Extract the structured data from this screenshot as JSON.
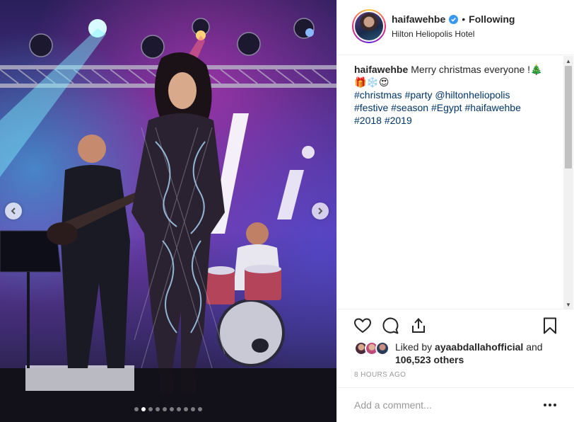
{
  "post": {
    "username": "haifawehbe",
    "separator": "•",
    "follow_status": "Following",
    "location": "Hilton Heliopolis Hotel"
  },
  "caption": {
    "username": "haifawehbe",
    "text": "Merry christmas everyone !🎄🎁❄️😍",
    "line2": [
      "#christmas",
      "#party",
      "@hiltonheliopolis"
    ],
    "line3": [
      "#festive",
      "#season",
      "#Egypt",
      "#haifawehbe"
    ],
    "line4": [
      "#2018",
      "#2019"
    ]
  },
  "likes": {
    "prefix": "Liked by",
    "user": "ayaabdallahofficial",
    "conjunction": "and",
    "count": "106,523 others"
  },
  "timestamp": "8 HOURS AGO",
  "comment": {
    "placeholder": "Add a comment..."
  },
  "carousel": {
    "total": 10,
    "active_index": 1
  },
  "icons": {
    "prev": "chevron-left-icon",
    "next": "chevron-right-icon",
    "like": "heart-icon",
    "comment": "comment-bubble-icon",
    "share": "share-icon",
    "save": "bookmark-icon",
    "verified": "verified-badge-icon",
    "more": "more-options-icon"
  },
  "colors": {
    "link": "#003569",
    "verified": "#3897f0",
    "muted": "#999999",
    "text": "#262626"
  }
}
